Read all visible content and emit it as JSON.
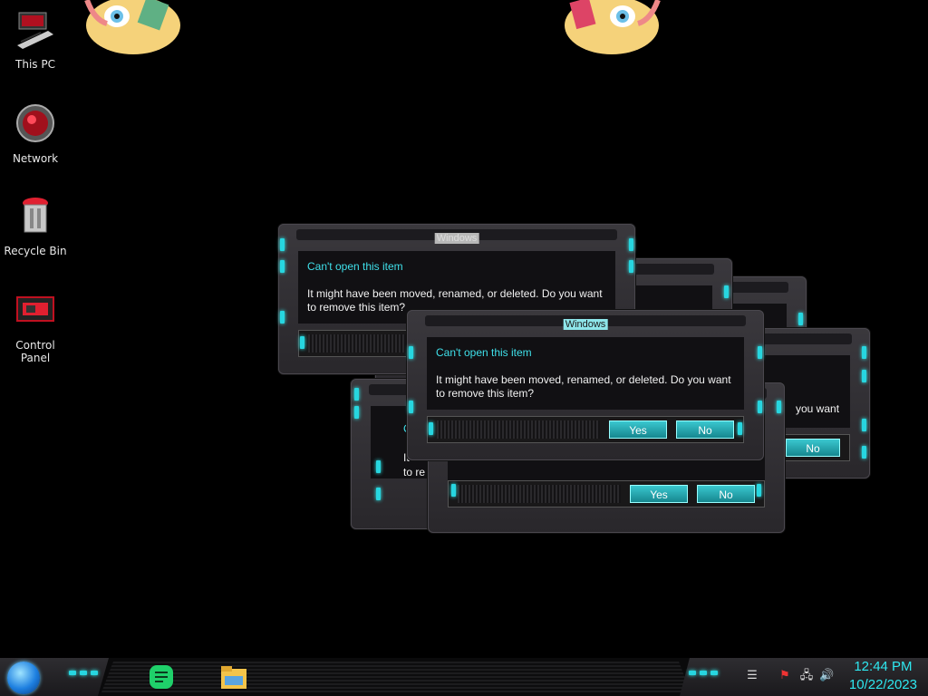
{
  "desktop": {
    "icons": [
      {
        "label": "This PC",
        "icon": "computer-icon"
      },
      {
        "label": "Network",
        "icon": "network-icon"
      },
      {
        "label": "Recycle Bin",
        "icon": "recycle-bin-icon"
      },
      {
        "label": "Control Panel",
        "icon": "control-panel-icon"
      }
    ]
  },
  "dialog": {
    "title": "Windows",
    "heading": "Can't open this item",
    "message": "It might have been moved, renamed, or deleted. Do you want to remove this item?",
    "yes_label": "Yes",
    "no_label": "No",
    "partial_heading_fragment": "C",
    "partial_msg_fragment_1": "It",
    "partial_msg_fragment_2": "to re",
    "partial_right_fragment": "you want"
  },
  "taskbar": {
    "pinned": [
      "notes-app-icon",
      "file-explorer-icon"
    ],
    "tray_icons": [
      "flag-icon",
      "network-icon",
      "volume-icon"
    ],
    "time": "12:44 PM",
    "date": "10/22/2023"
  },
  "colors": {
    "accent": "#2ee8f0",
    "button": "#22aab3",
    "frame": "#333136"
  }
}
